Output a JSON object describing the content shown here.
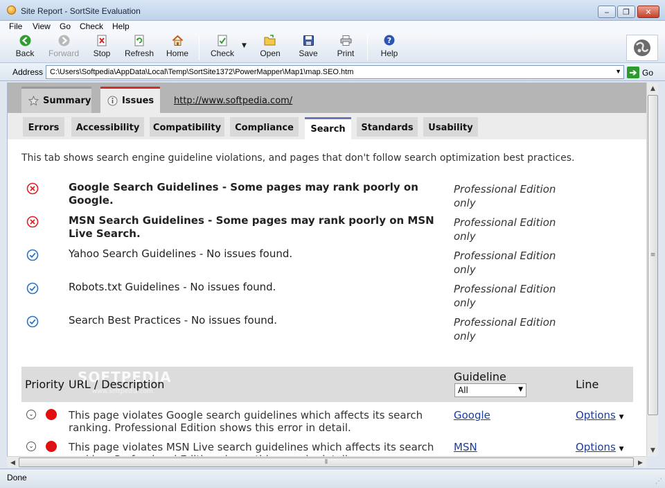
{
  "window": {
    "title": "Site Report - SortSite Evaluation",
    "minimize_glyph": "‒",
    "restore_glyph": "❐",
    "close_glyph": "✕"
  },
  "menu": [
    "File",
    "View",
    "Go",
    "Check",
    "Help"
  ],
  "toolbar": {
    "back": "Back",
    "forward": "Forward",
    "stop": "Stop",
    "refresh": "Refresh",
    "home": "Home",
    "check": "Check",
    "open": "Open",
    "save": "Save",
    "print": "Print",
    "help": "Help"
  },
  "address": {
    "label": "Address",
    "value": "C:\\Users\\Softpedia\\AppData\\Local\\Temp\\SortSite1372\\PowerMapper\\Map1\\map.SEO.htm",
    "go": "Go"
  },
  "report": {
    "top_tabs": {
      "summary": "Summary",
      "issues": "Issues",
      "site_link": "http://www.softpedia.com/"
    },
    "sub_tabs": [
      "Errors",
      "Accessibility",
      "Compatibility",
      "Compliance",
      "Search",
      "Standards",
      "Usability"
    ],
    "active_sub_tab": "Search",
    "description": "This tab shows search engine guideline violations, and pages that don't follow search optimization best practices.",
    "guidelines": [
      {
        "status": "fail",
        "text": "Google Search Guidelines - Some pages may rank poorly on Google.",
        "edition": "Professional Edition only"
      },
      {
        "status": "fail",
        "text": "MSN Search Guidelines - Some pages may rank poorly on MSN Live Search.",
        "edition": "Professional Edition only"
      },
      {
        "status": "pass",
        "text": "Yahoo Search Guidelines - No issues found.",
        "edition": "Professional Edition only"
      },
      {
        "status": "pass",
        "text": "Robots.txt Guidelines - No issues found.",
        "edition": "Professional Edition only"
      },
      {
        "status": "pass",
        "text": "Search Best Practices - No issues found.",
        "edition": "Professional Edition only"
      }
    ],
    "table": {
      "col_priority": "Priority",
      "col_url": "URL / Description",
      "col_guideline": "Guideline",
      "col_line": "Line",
      "guideline_filter": "All",
      "watermark": "SOFTPEDIA",
      "watermark_sub": "www.softpedia.com",
      "rows": [
        {
          "text": "This page violates Google search guidelines which affects its search ranking. Professional Edition shows this error in detail.",
          "guideline": "Google",
          "options": "Options"
        },
        {
          "text": "This page violates MSN Live search guidelines which affects its search ranking. Professional Edition shows this error in detail.",
          "guideline": "MSN",
          "options": "Options"
        }
      ]
    }
  },
  "status": {
    "text": "Done"
  },
  "colors": {
    "fail": "#e02020",
    "pass": "#2a73c9",
    "active_tab_border": "#d42b2b",
    "link": "#1b3d99"
  }
}
